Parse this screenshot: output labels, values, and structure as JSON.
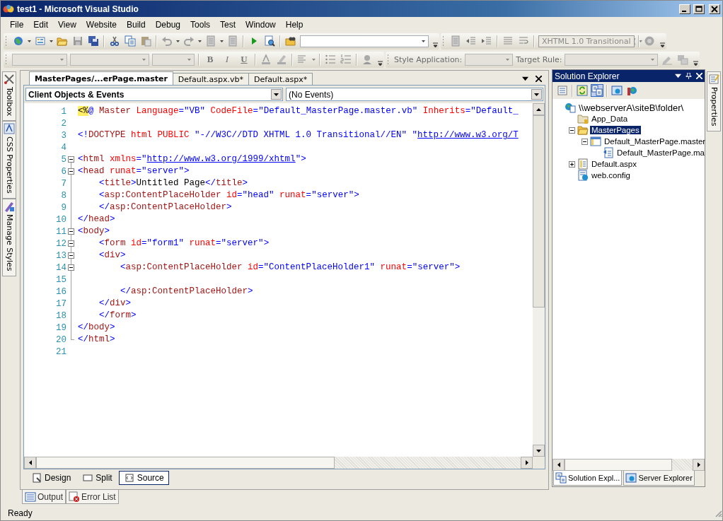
{
  "window": {
    "title": "test1 - Microsoft Visual Studio"
  },
  "menu": [
    "File",
    "Edit",
    "View",
    "Website",
    "Build",
    "Debug",
    "Tools",
    "Test",
    "Window",
    "Help"
  ],
  "toolbar": {
    "schema": {
      "value": "XHTML 1.0 Transitional (",
      "disabled": true
    }
  },
  "format_toolbar": {
    "buttons": [
      "B",
      "I",
      "U"
    ],
    "style_label": "Style Application:",
    "target_label": "Target Rule:"
  },
  "side_tabs": [
    "Toolbox",
    "CSS Properties",
    "Manage Styles"
  ],
  "editor": {
    "tabs": [
      {
        "label": "MasterPages/...erPage.master",
        "selected": true
      },
      {
        "label": "Default.aspx.vb*",
        "selected": false
      },
      {
        "label": "Default.aspx*",
        "selected": false
      }
    ],
    "object_dropdown": "Client Objects & Events",
    "event_dropdown": "(No Events)",
    "lines": [
      {
        "number": "1",
        "collapsible": false,
        "tokens": [
          {
            "kind": "directive",
            "text": "<%"
          },
          {
            "kind": "punct",
            "text": "@"
          },
          {
            "kind": "tag",
            "text": " Master"
          },
          {
            "kind": "attr",
            "text": " Language"
          },
          {
            "kind": "punct",
            "text": "="
          },
          {
            "kind": "value",
            "text": "\"VB\""
          },
          {
            "kind": "attr",
            "text": " CodeFile"
          },
          {
            "kind": "punct",
            "text": "="
          },
          {
            "kind": "value",
            "text": "\"Default_MasterPage.master.vb\""
          },
          {
            "kind": "attr",
            "text": " Inherits"
          },
          {
            "kind": "punct",
            "text": "="
          },
          {
            "kind": "value",
            "text": "\"Default_"
          }
        ]
      },
      {
        "number": "2",
        "collapsible": false
      },
      {
        "number": "3",
        "collapsible": false,
        "tokens": [
          {
            "kind": "punct",
            "text": "<!"
          },
          {
            "kind": "tag",
            "text": "DOCTYPE"
          },
          {
            "kind": "attr",
            "text": " html PUBLIC"
          },
          {
            "kind": "value",
            "text": " \"-//W3C//DTD XHTML 1.0 Transitional//EN\" \""
          },
          {
            "kind": "link",
            "text": "http://www.w3.org/T"
          }
        ]
      },
      {
        "number": "4",
        "collapsible": false
      },
      {
        "number": "5",
        "collapsible": true,
        "tokens": [
          {
            "kind": "punct",
            "text": "<"
          },
          {
            "kind": "tag",
            "text": "html"
          },
          {
            "kind": "attr",
            "text": " xmlns"
          },
          {
            "kind": "punct",
            "text": "="
          },
          {
            "kind": "value",
            "text": "\""
          },
          {
            "kind": "link",
            "text": "http://www.w3.org/1999/xhtml"
          },
          {
            "kind": "value",
            "text": "\""
          },
          {
            "kind": "punct",
            "text": ">"
          }
        ]
      },
      {
        "number": "6",
        "collapsible": true,
        "tokens": [
          {
            "kind": "punct",
            "text": "<"
          },
          {
            "kind": "tag",
            "text": "head"
          },
          {
            "kind": "attr",
            "text": " runat"
          },
          {
            "kind": "punct",
            "text": "="
          },
          {
            "kind": "value",
            "text": "\"server\""
          },
          {
            "kind": "punct",
            "text": ">"
          }
        ]
      },
      {
        "number": "7",
        "collapsible": false,
        "tokens": [
          {
            "kind": "punct",
            "text": "    <"
          },
          {
            "kind": "tag",
            "text": "title"
          },
          {
            "kind": "punct",
            "text": ">"
          },
          {
            "kind": "text",
            "text": "Untitled Page"
          },
          {
            "kind": "punct",
            "text": "</"
          },
          {
            "kind": "tag",
            "text": "title"
          },
          {
            "kind": "punct",
            "text": ">"
          }
        ]
      },
      {
        "number": "8",
        "collapsible": false,
        "tokens": [
          {
            "kind": "punct",
            "text": "    <"
          },
          {
            "kind": "tag",
            "text": "asp:ContentPlaceHolder"
          },
          {
            "kind": "attr",
            "text": " id"
          },
          {
            "kind": "punct",
            "text": "="
          },
          {
            "kind": "value",
            "text": "\"head\""
          },
          {
            "kind": "attr",
            "text": " runat"
          },
          {
            "kind": "punct",
            "text": "="
          },
          {
            "kind": "value",
            "text": "\"server\""
          },
          {
            "kind": "punct",
            "text": ">"
          }
        ]
      },
      {
        "number": "9",
        "collapsible": false,
        "tokens": [
          {
            "kind": "punct",
            "text": "    </"
          },
          {
            "kind": "tag",
            "text": "asp:ContentPlaceHolder"
          },
          {
            "kind": "punct",
            "text": ">"
          }
        ]
      },
      {
        "number": "10",
        "collapsible": false,
        "tokens": [
          {
            "kind": "punct",
            "text": "</"
          },
          {
            "kind": "tag",
            "text": "head"
          },
          {
            "kind": "punct",
            "text": ">"
          }
        ]
      },
      {
        "number": "11",
        "collapsible": true,
        "tokens": [
          {
            "kind": "punct",
            "text": "<"
          },
          {
            "kind": "tag",
            "text": "body"
          },
          {
            "kind": "punct",
            "text": ">"
          }
        ]
      },
      {
        "number": "12",
        "collapsible": true,
        "tokens": [
          {
            "kind": "punct",
            "text": "    <"
          },
          {
            "kind": "tag",
            "text": "form"
          },
          {
            "kind": "attr",
            "text": " id"
          },
          {
            "kind": "punct",
            "text": "="
          },
          {
            "kind": "value",
            "text": "\"form1\""
          },
          {
            "kind": "attr",
            "text": " runat"
          },
          {
            "kind": "punct",
            "text": "="
          },
          {
            "kind": "value",
            "text": "\"server\""
          },
          {
            "kind": "punct",
            "text": ">"
          }
        ]
      },
      {
        "number": "13",
        "collapsible": true,
        "tokens": [
          {
            "kind": "punct",
            "text": "    <"
          },
          {
            "kind": "tag",
            "text": "div"
          },
          {
            "kind": "punct",
            "text": ">"
          }
        ]
      },
      {
        "number": "14",
        "collapsible": true,
        "tokens": [
          {
            "kind": "punct",
            "text": "        <"
          },
          {
            "kind": "tag",
            "text": "asp:ContentPlaceHolder"
          },
          {
            "kind": "attr",
            "text": " id"
          },
          {
            "kind": "punct",
            "text": "="
          },
          {
            "kind": "value",
            "text": "\"ContentPlaceHolder1\""
          },
          {
            "kind": "attr",
            "text": " runat"
          },
          {
            "kind": "punct",
            "text": "="
          },
          {
            "kind": "value",
            "text": "\"server\""
          },
          {
            "kind": "punct",
            "text": ">"
          }
        ]
      },
      {
        "number": "15",
        "collapsible": false
      },
      {
        "number": "16",
        "collapsible": false,
        "tokens": [
          {
            "kind": "punct",
            "text": "        </"
          },
          {
            "kind": "tag",
            "text": "asp:ContentPlaceHolder"
          },
          {
            "kind": "punct",
            "text": ">"
          }
        ]
      },
      {
        "number": "17",
        "collapsible": false,
        "tokens": [
          {
            "kind": "punct",
            "text": "    </"
          },
          {
            "kind": "tag",
            "text": "div"
          },
          {
            "kind": "punct",
            "text": ">"
          }
        ]
      },
      {
        "number": "18",
        "collapsible": false,
        "tokens": [
          {
            "kind": "punct",
            "text": "    </"
          },
          {
            "kind": "tag",
            "text": "form"
          },
          {
            "kind": "punct",
            "text": ">"
          }
        ]
      },
      {
        "number": "19",
        "collapsible": false,
        "tokens": [
          {
            "kind": "punct",
            "text": "</"
          },
          {
            "kind": "tag",
            "text": "body"
          },
          {
            "kind": "punct",
            "text": ">"
          }
        ]
      },
      {
        "number": "20",
        "collapsible": false,
        "tokens": [
          {
            "kind": "punct",
            "text": "</"
          },
          {
            "kind": "tag",
            "text": "html"
          },
          {
            "kind": "punct",
            "text": ">"
          }
        ]
      },
      {
        "number": "21",
        "collapsible": false
      }
    ],
    "view_tabs": [
      {
        "label": "Design",
        "selected": false
      },
      {
        "label": "Split",
        "selected": false
      },
      {
        "label": "Source",
        "selected": true
      }
    ]
  },
  "bottom_tabs": [
    "Output",
    "Error List"
  ],
  "solution_explorer": {
    "title": "Solution Explorer",
    "tree": [
      {
        "label": "\\\\webserverA\\siteB\\folder\\",
        "kind": "site",
        "selected": false,
        "children": [
          {
            "label": "App_Data",
            "kind": "folder",
            "selected": false
          },
          {
            "label": "MasterPages",
            "kind": "folder-open",
            "selected": true,
            "expanded": true,
            "children": [
              {
                "label": "Default_MasterPage.master",
                "kind": "master",
                "selected": false,
                "expanded": true,
                "children": [
                  {
                    "label": "Default_MasterPage.ma",
                    "kind": "code",
                    "selected": false
                  }
                ]
              }
            ]
          },
          {
            "label": "Default.aspx",
            "kind": "page",
            "selected": false,
            "expanded": false
          },
          {
            "label": "web.config",
            "kind": "config",
            "selected": false
          }
        ]
      }
    ],
    "tabs": [
      {
        "label": "Solution Expl...",
        "selected": true
      },
      {
        "label": "Server Explorer",
        "selected": false
      }
    ]
  },
  "properties_tab": "Properties",
  "status_bar": "Ready"
}
